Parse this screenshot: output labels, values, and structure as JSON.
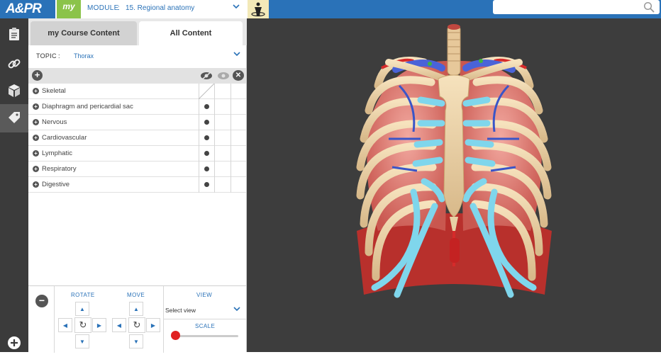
{
  "header": {
    "logo": "A&PR",
    "my_tab": "my",
    "module_label": "MODULE",
    "module_sep": ":",
    "module_value": "15. Regional anatomy",
    "search_placeholder": ""
  },
  "sidebar": {
    "items": [
      "clipboard-icon",
      "link-icon",
      "cube-icon",
      "tag-icon",
      "add-icon"
    ]
  },
  "tabs": {
    "my_course": "my Course Content",
    "all_content": "All Content"
  },
  "topic": {
    "label": "TOPIC",
    "sep": ":",
    "value": "Thorax"
  },
  "layers": [
    {
      "label": "Skeletal",
      "dot": false
    },
    {
      "label": "Diaphragm and pericardial sac",
      "dot": true
    },
    {
      "label": "Nervous",
      "dot": true
    },
    {
      "label": "Cardiovascular",
      "dot": true
    },
    {
      "label": "Lymphatic",
      "dot": true
    },
    {
      "label": "Respiratory",
      "dot": true
    },
    {
      "label": "Digestive",
      "dot": true
    }
  ],
  "controls": {
    "rotate": "ROTATE",
    "move": "MOVE",
    "view": "VIEW",
    "view_select": "Select view",
    "scale": "SCALE",
    "scale_value": 0.0
  },
  "colors": {
    "brand_blue": "#2a72b8",
    "my_green": "#8bc34a",
    "viewport_bg": "#3d3d3d",
    "scale_thumb": "#e02020"
  }
}
